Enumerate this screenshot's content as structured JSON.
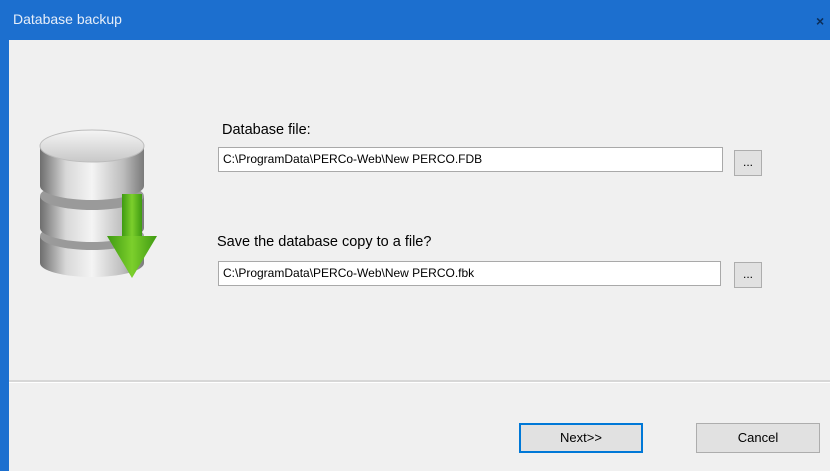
{
  "window": {
    "title": "Database backup",
    "close_glyph": "×"
  },
  "icon": {
    "name": "database-download-icon"
  },
  "database_file": {
    "label": "Database file:",
    "value": "C:\\ProgramData\\PERCo-Web\\New PERCO.FDB",
    "browse_label": "..."
  },
  "backup_file": {
    "label": "Save the database copy to a file?",
    "value": "C:\\ProgramData\\PERCo-Web\\New PERCO.fbk",
    "browse_label": "..."
  },
  "buttons": {
    "next": "Next>>",
    "cancel": "Cancel"
  },
  "colors": {
    "titlebar": "#1c6fcf",
    "arrow": "#5cb41c",
    "default_button_border": "#0078d7"
  }
}
